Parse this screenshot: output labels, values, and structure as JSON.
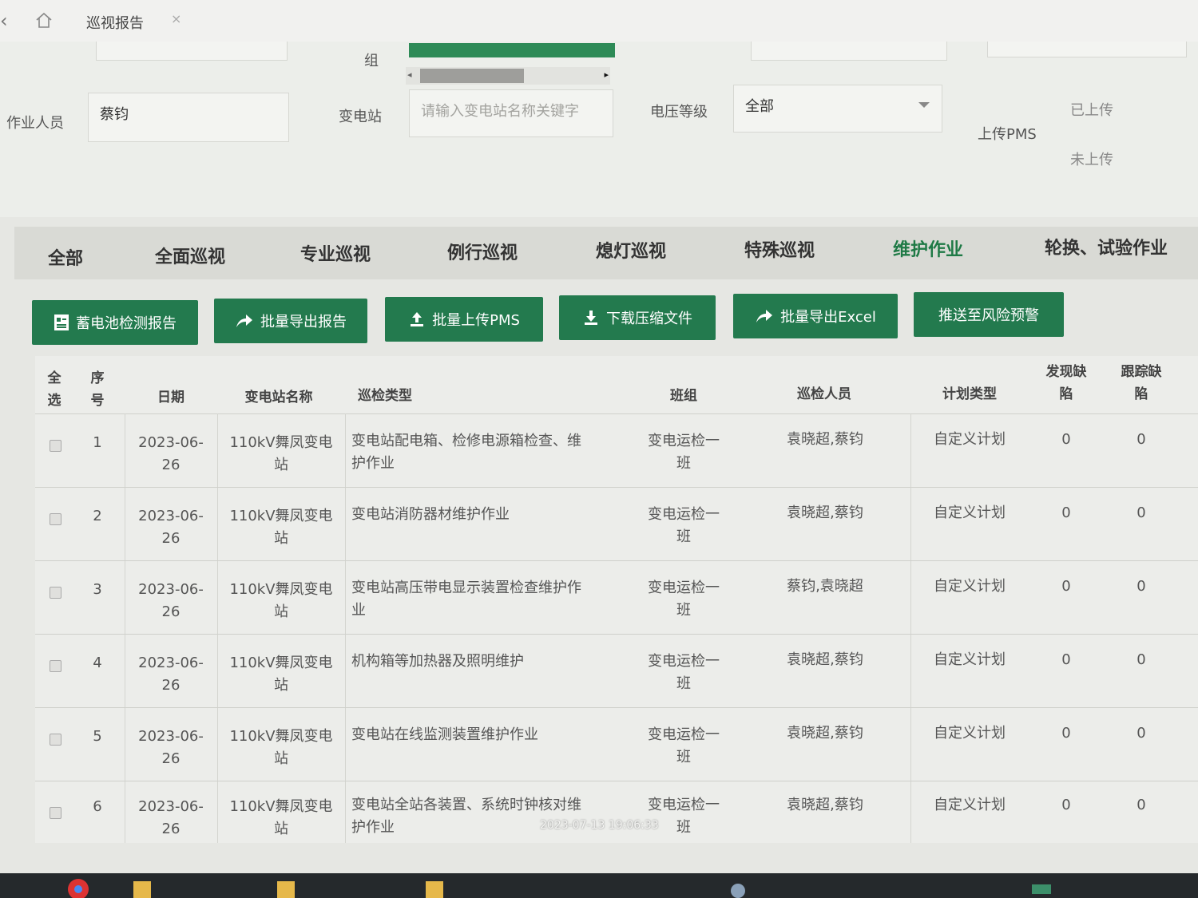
{
  "tab": {
    "title": "巡视报告",
    "close": "×"
  },
  "filters": {
    "group_label": "组",
    "worker_label": "作业人员",
    "worker_value": "蔡钧",
    "substation_label": "变电站",
    "substation_placeholder": "请输入变电站名称关键字",
    "voltage_label": "电压等级",
    "voltage_value": "全部",
    "pms_label": "上传PMS",
    "pms_uploaded": "已上传",
    "pms_not_uploaded": "未上传"
  },
  "categories": [
    {
      "label": "全部"
    },
    {
      "label": "全面巡视"
    },
    {
      "label": "专业巡视"
    },
    {
      "label": "例行巡视"
    },
    {
      "label": "熄灯巡视"
    },
    {
      "label": "特殊巡视"
    },
    {
      "label": "维护作业",
      "active": true
    },
    {
      "label": "轮换、试验作业"
    }
  ],
  "buttons": [
    {
      "label": "蓄电池检测报告",
      "icon": "report-icon"
    },
    {
      "label": "批量导出报告",
      "icon": "share-arrow-icon"
    },
    {
      "label": "批量上传PMS",
      "icon": "upload-icon"
    },
    {
      "label": "下载压缩文件",
      "icon": "download-icon"
    },
    {
      "label": "批量导出Excel",
      "icon": "share-arrow-icon"
    },
    {
      "label": "推送至风险预警",
      "icon": ""
    }
  ],
  "table": {
    "headers": {
      "select_all": [
        "全",
        "选"
      ],
      "index": [
        "序",
        "号"
      ],
      "date": "日期",
      "substation": "变电站名称",
      "type": "巡检类型",
      "team": "班组",
      "inspectors": "巡检人员",
      "plan_type": "计划类型",
      "found_defects": [
        "发现缺",
        "陷"
      ],
      "tracked_defects": [
        "跟踪缺",
        "陷"
      ]
    },
    "rows": [
      {
        "no": "1",
        "date": [
          "2023-06-",
          "26"
        ],
        "substation": [
          "110kV舞凤变电",
          "站"
        ],
        "type": [
          "变电站配电箱、检修电源箱检查、维",
          "护作业"
        ],
        "team": [
          "变电运检一",
          "班"
        ],
        "inspectors": "袁晓超,蔡钧",
        "plan": "自定义计划",
        "found": "0",
        "tracked": "0"
      },
      {
        "no": "2",
        "date": [
          "2023-06-",
          "26"
        ],
        "substation": [
          "110kV舞凤变电",
          "站"
        ],
        "type": [
          "变电站消防器材维护作业",
          ""
        ],
        "team": [
          "变电运检一",
          "班"
        ],
        "inspectors": "袁晓超,蔡钧",
        "plan": "自定义计划",
        "found": "0",
        "tracked": "0"
      },
      {
        "no": "3",
        "date": [
          "2023-06-",
          "26"
        ],
        "substation": [
          "110kV舞凤变电",
          "站"
        ],
        "type": [
          "变电站高压带电显示装置检查维护作",
          "业"
        ],
        "team": [
          "变电运检一",
          "班"
        ],
        "inspectors": "蔡钧,袁晓超",
        "plan": "自定义计划",
        "found": "0",
        "tracked": "0"
      },
      {
        "no": "4",
        "date": [
          "2023-06-",
          "26"
        ],
        "substation": [
          "110kV舞凤变电",
          "站"
        ],
        "type": [
          "机构箱等加热器及照明维护",
          ""
        ],
        "team": [
          "变电运检一",
          "班"
        ],
        "inspectors": "袁晓超,蔡钧",
        "plan": "自定义计划",
        "found": "0",
        "tracked": "0"
      },
      {
        "no": "5",
        "date": [
          "2023-06-",
          "26"
        ],
        "substation": [
          "110kV舞凤变电",
          "站"
        ],
        "type": [
          "变电站在线监测装置维护作业",
          ""
        ],
        "team": [
          "变电运检一",
          "班"
        ],
        "inspectors": "袁晓超,蔡钧",
        "plan": "自定义计划",
        "found": "0",
        "tracked": "0"
      },
      {
        "no": "6",
        "date": [
          "2023-06-",
          "26"
        ],
        "substation": [
          "110kV舞凤变电",
          "站"
        ],
        "type": [
          "变电站全站各装置、系统时钟核对维",
          "护作业"
        ],
        "team": [
          "变电运检一",
          "班"
        ],
        "inspectors": "袁晓超,蔡钧",
        "plan": "自定义计划",
        "found": "0",
        "tracked": "0"
      }
    ]
  },
  "timestamp": "2023-07-13 19:06:33",
  "colors": {
    "accent": "#237a4e",
    "active_tab": "#1f7a46"
  }
}
